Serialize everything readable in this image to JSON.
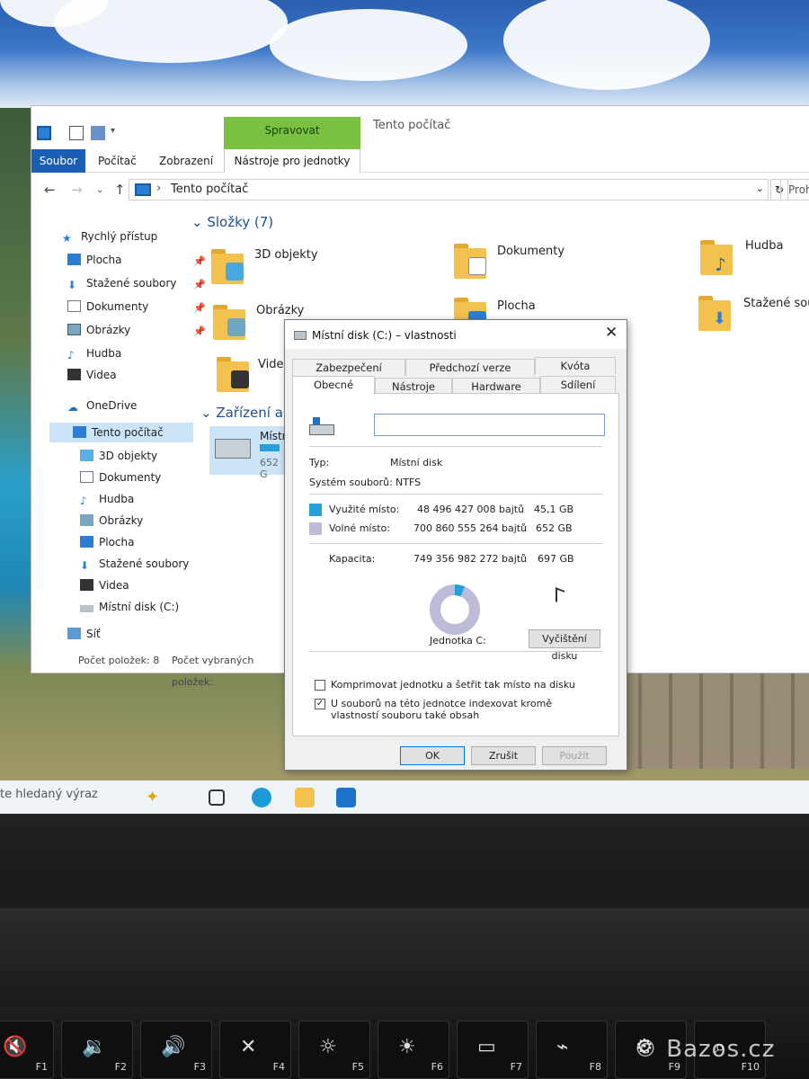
{
  "explorer": {
    "window_title": "Tento počítač",
    "ribbon": {
      "file_tab": "Soubor",
      "tabs": [
        "Počítač",
        "Zobrazení"
      ],
      "context_group": "Spravovat",
      "context_tab": "Nástroje pro jednotky"
    },
    "address": {
      "crumb": "Tento počítač",
      "search_placeholder": "Proh"
    },
    "sidebar": {
      "quick_access": "Rychlý přístup",
      "quick_items": [
        "Plocha",
        "Stažené soubory",
        "Dokumenty",
        "Obrázky",
        "Hudba",
        "Videa"
      ],
      "onedrive": "OneDrive",
      "this_pc": "Tento počítač",
      "pc_items": [
        "3D objekty",
        "Dokumenty",
        "Hudba",
        "Obrázky",
        "Plocha",
        "Stažené soubory",
        "Videa",
        "Místní disk (C:)"
      ],
      "network": "Síť"
    },
    "folders_header": "Složky (7)",
    "folders": [
      "3D objekty",
      "Dokumenty",
      "Hudba",
      "Obrázky",
      "Plocha",
      "Stažené soub",
      "Videa"
    ],
    "devices_header": "Zařízení a je",
    "device": {
      "name": "Místní",
      "free": "652 G"
    },
    "status": {
      "items": "Počet položek: 8",
      "selected": "Počet vybraných položek:"
    }
  },
  "dialog": {
    "title": "Místní disk (C:) – vlastnosti",
    "tabs_row1": [
      "Zabezpečení",
      "Předchozí verze",
      "Kvóta"
    ],
    "tabs_row2": [
      "Obecné",
      "Nástroje",
      "Hardware",
      "Sdílení"
    ],
    "name_value": "",
    "type_label": "Typ:",
    "type_value": "Místní disk",
    "fs_label": "Systém souborů:",
    "fs_value": "NTFS",
    "used_label": "Využité místo:",
    "used_bytes": "48 496 427 008 bajtů",
    "used_gb": "45,1 GB",
    "free_label": "Volné místo:",
    "free_bytes": "700 860 555 264 bajtů",
    "free_gb": "652 GB",
    "cap_label": "Kapacita:",
    "cap_bytes": "749 356 982 272 bajtů",
    "cap_gb": "697 GB",
    "drive_label": "Jednotka C:",
    "cleanup": "Vyčištění disku",
    "compress": "Komprimovat jednotku a šetřit tak místo na disku",
    "index": "U souborů na této jednotce indexovat kromě vlastností souboru také obsah",
    "compress_checked": false,
    "index_checked": true,
    "used_fraction": 0.065,
    "colors": {
      "used": "#26a0da",
      "free": "#bcbcd8"
    },
    "buttons": {
      "ok": "OK",
      "cancel": "Zrušit",
      "apply": "Použít"
    }
  },
  "taskbar": {
    "search_text": "te hledaný výraz"
  },
  "keyboard": {
    "keys": [
      {
        "label": "F1",
        "icon": "mute-icon"
      },
      {
        "label": "F2",
        "icon": "volume-down-icon"
      },
      {
        "label": "F3",
        "icon": "volume-up-icon"
      },
      {
        "label": "F4",
        "icon": "mic-mute-icon"
      },
      {
        "label": "F5",
        "icon": "brightness-down-icon"
      },
      {
        "label": "F6",
        "icon": "brightness-up-icon"
      },
      {
        "label": "F7",
        "icon": "display-icon"
      },
      {
        "label": "F8",
        "icon": "wireless-icon"
      },
      {
        "label": "F9",
        "icon": "settings-icon"
      },
      {
        "label": "F10",
        "icon": "search-icon"
      }
    ]
  },
  "watermark": "© Bazos.cz"
}
